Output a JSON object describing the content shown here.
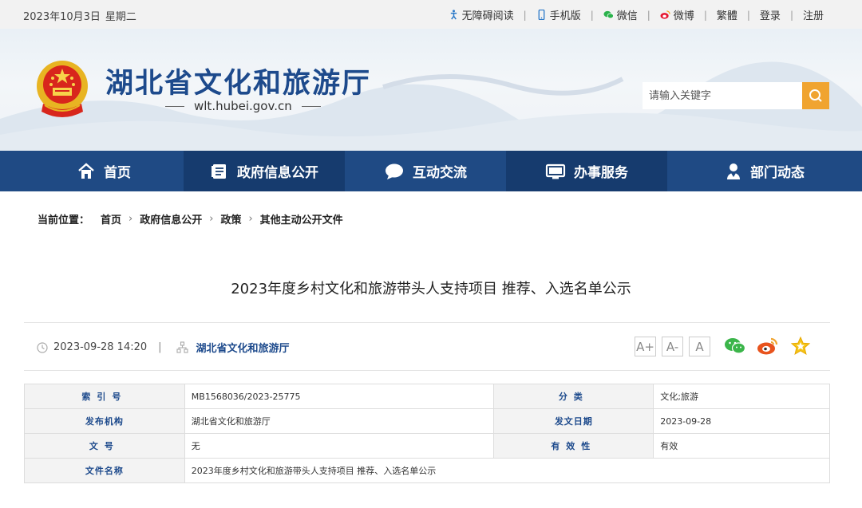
{
  "topbar": {
    "date": "2023年10月3日",
    "weekday": "星期二",
    "links": [
      {
        "label": "无障碍阅读",
        "icon": "accessibility-icon"
      },
      {
        "label": "手机版",
        "icon": "mobile-icon"
      },
      {
        "label": "微信",
        "icon": "wechat-icon"
      },
      {
        "label": "微博",
        "icon": "weibo-icon"
      },
      {
        "label": "繁體"
      },
      {
        "label": "登录"
      },
      {
        "label": "注册"
      }
    ]
  },
  "header": {
    "site_title": "湖北省文化和旅游厅",
    "domain": "wlt.hubei.gov.cn",
    "search_placeholder": "请输入关键字",
    "search_icon": "search-icon"
  },
  "nav": [
    {
      "label": "首页",
      "icon": "home-icon"
    },
    {
      "label": "政府信息公开",
      "icon": "document-icon"
    },
    {
      "label": "互动交流",
      "icon": "chat-bubble-icon"
    },
    {
      "label": "办事服务",
      "icon": "monitor-icon"
    },
    {
      "label": "部门动态",
      "icon": "person-icon"
    }
  ],
  "breadcrumb": {
    "label": "当前位置：",
    "items": [
      "首页",
      "政府信息公开",
      "政策",
      "其他主动公开文件"
    ]
  },
  "article": {
    "title": "2023年度乡村文化和旅游带头人支持项目 推荐、入选名单公示",
    "datetime": "2023-09-28 14:20",
    "source": "湖北省文化和旅游厅",
    "font_sizes": [
      "A+",
      "A-",
      "A"
    ],
    "share": [
      "wechat-share-icon",
      "weibo-share-icon",
      "favorite-star-icon"
    ]
  },
  "info_table": {
    "rows": [
      {
        "k1": "索引号",
        "v1": "MB1568036/2023-25775",
        "k2": "分类",
        "v2": "文化;旅游"
      },
      {
        "k1": "发布机构",
        "v1": "湖北省文化和旅游厅",
        "k2": "发文日期",
        "v2": "2023-09-28"
      },
      {
        "k1": "文号",
        "v1": "无",
        "k2": "有效性",
        "v2": "有效"
      },
      {
        "k1": "文件名称",
        "v1": "2023年度乡村文化和旅游带头人支持项目 推荐、入选名单公示"
      }
    ]
  },
  "colors": {
    "brand_blue": "#1f4a84",
    "nav_active": "#163b6e",
    "search_button": "#f0a430"
  }
}
